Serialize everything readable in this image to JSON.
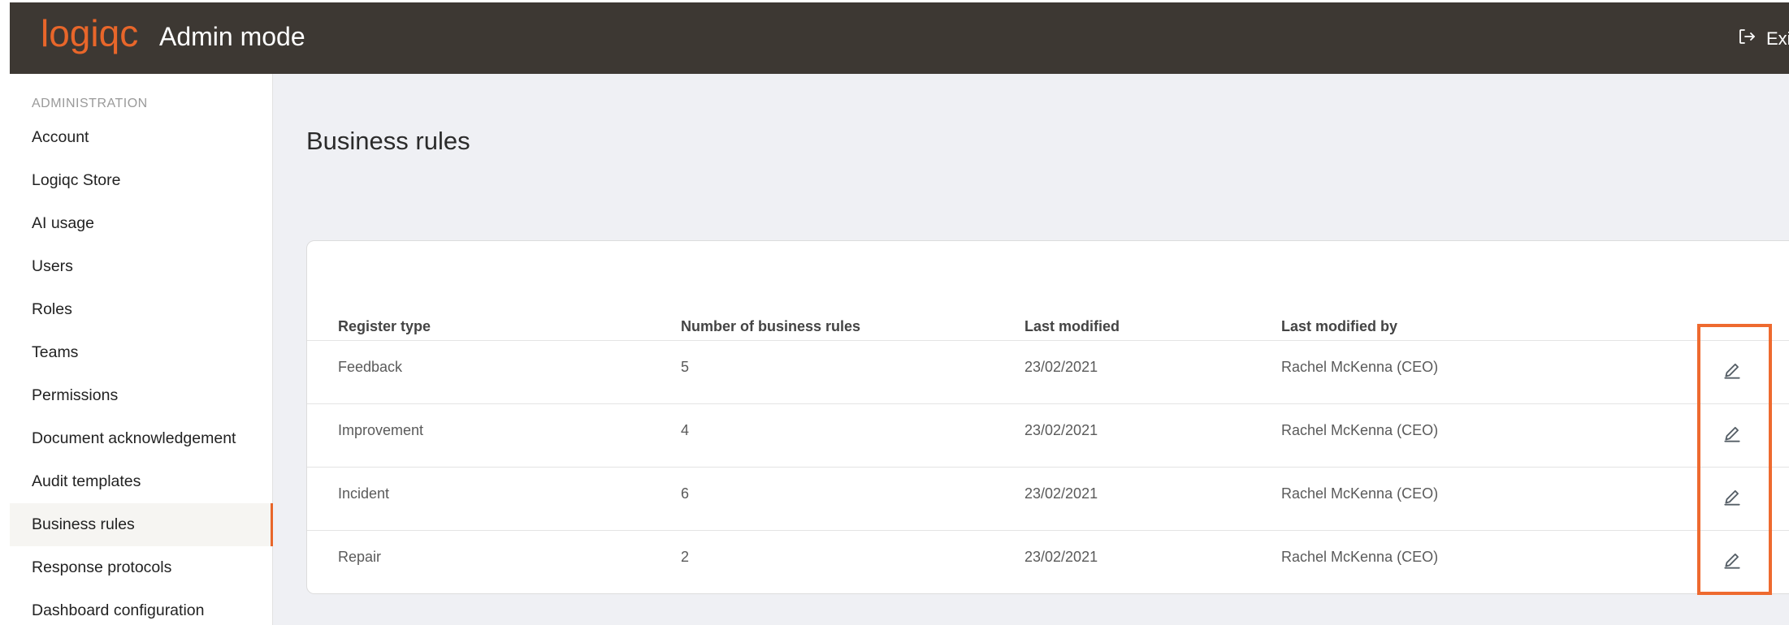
{
  "header": {
    "logo_text": "logiqc",
    "title": "Admin mode",
    "exit_label": "Exit",
    "exit_icon": "logout-icon",
    "brand_color": "#e8662a",
    "bar_color": "#3d3833"
  },
  "sidebar": {
    "heading": "ADMINISTRATION",
    "items": [
      {
        "label": "Account"
      },
      {
        "label": "Logiqc Store"
      },
      {
        "label": "AI usage"
      },
      {
        "label": "Users"
      },
      {
        "label": "Roles"
      },
      {
        "label": "Teams"
      },
      {
        "label": "Permissions"
      },
      {
        "label": "Document acknowledgement"
      },
      {
        "label": "Audit templates"
      },
      {
        "label": "Business rules",
        "active": true
      },
      {
        "label": "Response protocols"
      },
      {
        "label": "Dashboard configuration"
      }
    ]
  },
  "main": {
    "title": "Business rules",
    "table": {
      "columns": [
        "Register type",
        "Number of business rules",
        "Last modified",
        "Last modified by"
      ],
      "rows": [
        {
          "register_type": "Feedback",
          "count": "5",
          "last_modified": "23/02/2021",
          "modified_by": "Rachel McKenna (CEO)"
        },
        {
          "register_type": "Improvement",
          "count": "4",
          "last_modified": "23/02/2021",
          "modified_by": "Rachel McKenna (CEO)"
        },
        {
          "register_type": "Incident",
          "count": "6",
          "last_modified": "23/02/2021",
          "modified_by": "Rachel McKenna (CEO)"
        },
        {
          "register_type": "Repair",
          "count": "2",
          "last_modified": "23/02/2021",
          "modified_by": "Rachel McKenna (CEO)"
        }
      ],
      "edit_icon": "pencil-icon"
    },
    "highlight_color": "#ee6a2f"
  }
}
